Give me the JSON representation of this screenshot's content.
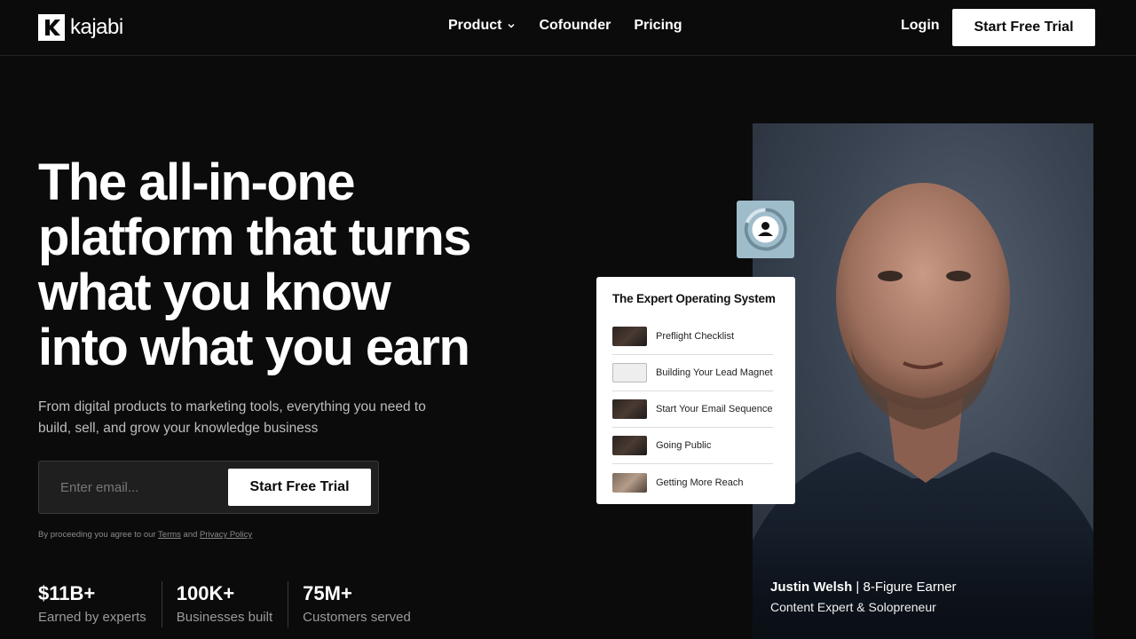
{
  "brand": {
    "name": "kajabi",
    "logo_icon": "kajabi-logo-icon"
  },
  "nav": {
    "links": [
      {
        "label": "Product",
        "has_dropdown": true
      },
      {
        "label": "Cofounder",
        "has_dropdown": false
      },
      {
        "label": "Pricing",
        "has_dropdown": false
      }
    ],
    "login_label": "Login",
    "cta_label": "Start Free Trial"
  },
  "hero": {
    "title_lines": [
      "The all-in-one",
      "platform that turns",
      "what you know",
      "into what you earn"
    ],
    "subtitle": "From digital products to marketing tools, everything you need to build, sell, and grow your knowledge business",
    "email_placeholder": "Enter email...",
    "cta_label": "Start Free Trial",
    "legal_prefix": "By proceeding you agree to our",
    "legal_terms": "Terms",
    "legal_and": "and",
    "legal_privacy": "Privacy Policy"
  },
  "stats": [
    {
      "value": "$11B+",
      "label": "Earned by experts"
    },
    {
      "value": "100K+",
      "label": "Businesses built"
    },
    {
      "value": "75M+",
      "label": "Customers served"
    }
  ],
  "card": {
    "title": "The Expert Operating System",
    "items": [
      {
        "label": "Preflight Checklist",
        "thumb": "dark"
      },
      {
        "label": "Building Your Lead Magnet",
        "thumb": "light"
      },
      {
        "label": "Start Your Email Sequence",
        "thumb": "dark"
      },
      {
        "label": "Going Public",
        "thumb": "dark"
      },
      {
        "label": "Getting More Reach",
        "thumb": "warm"
      }
    ]
  },
  "badge": {
    "icon": "user-progress-icon"
  },
  "featured": {
    "name": "Justin Welsh",
    "separator": " | ",
    "tagline": "8-Figure Earner",
    "role": "Content Expert & Solopreneur"
  },
  "colors": {
    "background": "#0b0b0b",
    "button": "#ffffff",
    "badge": "#9fbccb",
    "muted_text": "#9a9a9a"
  }
}
